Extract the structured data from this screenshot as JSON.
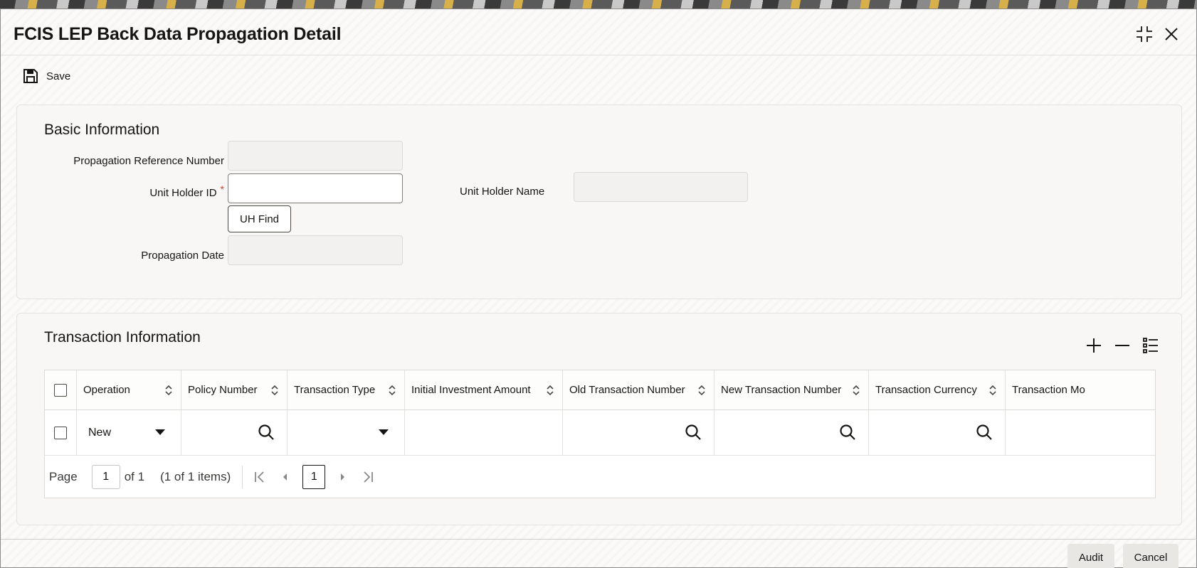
{
  "window": {
    "title": "FCIS LEP Back Data Propagation Detail"
  },
  "toolbar": {
    "save_label": "Save"
  },
  "basic": {
    "title": "Basic Information",
    "propagation_ref_label": "Propagation Reference Number",
    "propagation_ref_value": "",
    "unit_holder_id_label": "Unit Holder ID",
    "required_mark": "*",
    "unit_holder_id_value": "",
    "uh_find_label": "UH Find",
    "unit_holder_name_label": "Unit Holder Name",
    "unit_holder_name_value": "",
    "propagation_date_label": "Propagation Date",
    "propagation_date_value": ""
  },
  "transaction": {
    "title": "Transaction Information",
    "columns": [
      "Operation",
      "Policy Number",
      "Transaction Type",
      "Initial Investment Amount",
      "Old Transaction Number",
      "New Transaction Number",
      "Transaction Currency",
      "Transaction Mo"
    ],
    "rows": [
      {
        "operation": "New",
        "policy_number": "",
        "transaction_type": "",
        "initial_investment_amount": "",
        "old_transaction_number": "",
        "new_transaction_number": "",
        "transaction_currency": "",
        "transaction_mode": ""
      }
    ],
    "pager": {
      "page_label": "Page",
      "page_value": "1",
      "of_label": "of 1",
      "items_label": "(1 of 1 items)",
      "current_page": "1"
    }
  },
  "footer": {
    "audit_label": "Audit",
    "cancel_label": "Cancel"
  },
  "icons": {
    "save": "save-icon",
    "maximize": "maximize-icon",
    "close": "close-icon",
    "add": "add-row-icon",
    "remove": "remove-row-icon",
    "columns": "column-list-icon",
    "search": "search-icon",
    "sort": "sort-icon"
  },
  "colors": {
    "required": "#c74634",
    "text": "#161513"
  }
}
